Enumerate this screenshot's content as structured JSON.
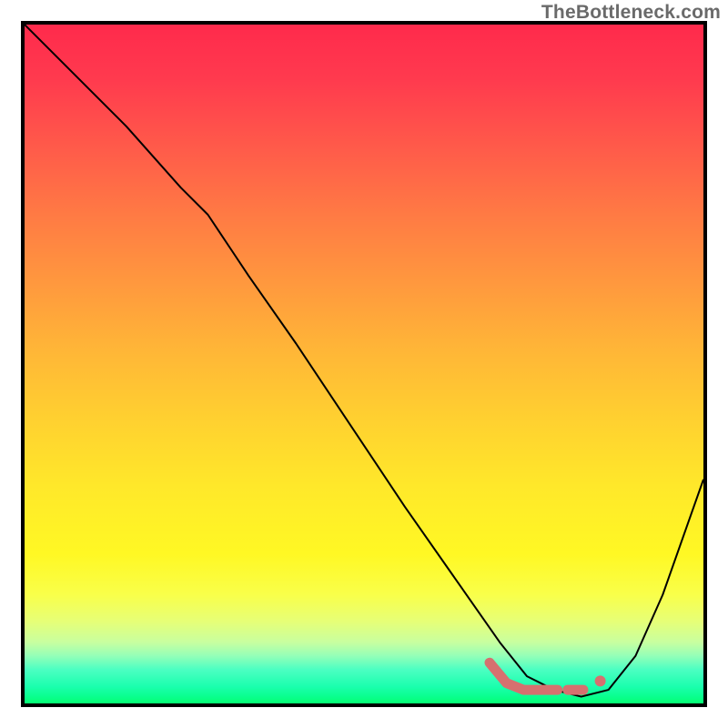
{
  "watermark": "TheBottleneck.com",
  "chart_data": {
    "type": "line",
    "title": "",
    "xlabel": "",
    "ylabel": "",
    "xlim": [
      0,
      100
    ],
    "ylim": [
      0,
      100
    ],
    "series": [
      {
        "name": "black-curve",
        "color": "#000000",
        "stroke_width": 2,
        "x": [
          0,
          8,
          15,
          23,
          27,
          33,
          40,
          48,
          56,
          63,
          70,
          74,
          78,
          82,
          86,
          90,
          94,
          100
        ],
        "values": [
          100,
          92,
          85,
          76,
          72,
          63,
          53,
          41,
          29,
          19,
          9,
          4,
          2,
          1,
          2,
          7,
          16,
          33
        ]
      },
      {
        "name": "salmon-marker-segment",
        "color": "#d6706f",
        "stroke_width": 11,
        "linecap": "round",
        "x": [
          68.5,
          71.0,
          73.5,
          75.0,
          78.5
        ],
        "values": [
          6.0,
          3.0,
          2.0,
          2.0,
          2.0
        ]
      },
      {
        "name": "salmon-dash-1",
        "color": "#d6706f",
        "stroke_width": 11,
        "linecap": "round",
        "x": [
          80.0,
          82.3
        ],
        "values": [
          2.0,
          2.0
        ]
      },
      {
        "name": "salmon-dot-1",
        "color": "#d6706f",
        "marker_radius": 6,
        "x": [
          84.8
        ],
        "values": [
          3.3
        ]
      }
    ],
    "annotations": []
  }
}
